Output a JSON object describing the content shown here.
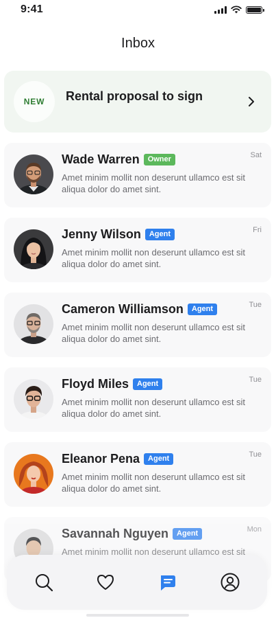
{
  "status_bar": {
    "time": "9:41"
  },
  "header": {
    "title": "Inbox"
  },
  "proposal": {
    "badge": "NEW",
    "title": "Rental proposal to sign",
    "badge_color": "#2e7d32",
    "background": "#f1f6f1"
  },
  "messages": [
    {
      "name": "Wade Warren",
      "role": "Owner",
      "day": "Sat",
      "preview": "Amet minim mollit non deserunt ullamco est sit aliqua dolor do amet sint."
    },
    {
      "name": "Jenny Wilson",
      "role": "Agent",
      "day": "Fri",
      "preview": "Amet minim mollit non deserunt ullamco est sit aliqua dolor do amet sint."
    },
    {
      "name": "Cameron Williamson",
      "role": "Agent",
      "day": "Tue",
      "preview": "Amet minim mollit non deserunt ullamco est sit aliqua dolor do amet sint."
    },
    {
      "name": "Floyd Miles",
      "role": "Agent",
      "day": "Tue",
      "preview": "Amet minim mollit non deserunt ullamco est sit aliqua dolor do amet sint."
    },
    {
      "name": "Eleanor Pena",
      "role": "Agent",
      "day": "Tue",
      "preview": "Amet minim mollit non deserunt ullamco est sit aliqua dolor do amet sint."
    },
    {
      "name": "Savannah Nguyen",
      "role": "Agent",
      "day": "Mon",
      "preview": "Amet minim mollit non deserunt ullamco est sit aliqua dolor do amet sint."
    }
  ],
  "colors": {
    "owner_badge": "#5cb85c",
    "agent_badge": "#2f80ed",
    "nav_active": "#2f80ed",
    "nav_inactive": "#1c1c1e"
  },
  "bottom_nav": [
    {
      "icon": "search-icon",
      "active": false
    },
    {
      "icon": "heart-icon",
      "active": false
    },
    {
      "icon": "chat-icon",
      "active": true
    },
    {
      "icon": "profile-icon",
      "active": false
    }
  ]
}
